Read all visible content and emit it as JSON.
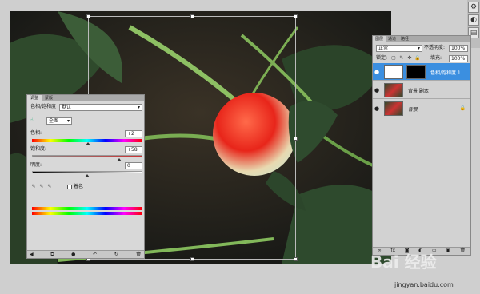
{
  "adjustments": {
    "tabs": [
      "调整",
      "蒙版"
    ],
    "preset_label": "色相/饱和度",
    "preset_value": "默认",
    "channel_value": "全图",
    "hue_label": "色相:",
    "hue_value": "+2",
    "hue_level": 0.51,
    "saturation_label": "饱和度:",
    "saturation_value": "+58",
    "saturation_level": 0.79,
    "lightness_label": "明度:",
    "lightness_value": "0",
    "lightness_level": 0.5,
    "colorize_label": "着色"
  },
  "layers": {
    "tabs": [
      "图层",
      "通道",
      "路径"
    ],
    "blend_mode": "正常",
    "opacity_label": "不透明度:",
    "opacity_value": "100%",
    "lock_label": "锁定:",
    "fill_label": "填充:",
    "fill_value": "100%",
    "items": [
      {
        "name": "色相/饱和度 1"
      },
      {
        "name": "背景 副本"
      },
      {
        "name": "背景"
      }
    ]
  },
  "watermark": {
    "logo": "Bai 经验",
    "url": "jingyan.baidu.com"
  },
  "colors": {
    "selected_layer": "#3b8fe0",
    "panel_bg": "#d8d8d8"
  }
}
